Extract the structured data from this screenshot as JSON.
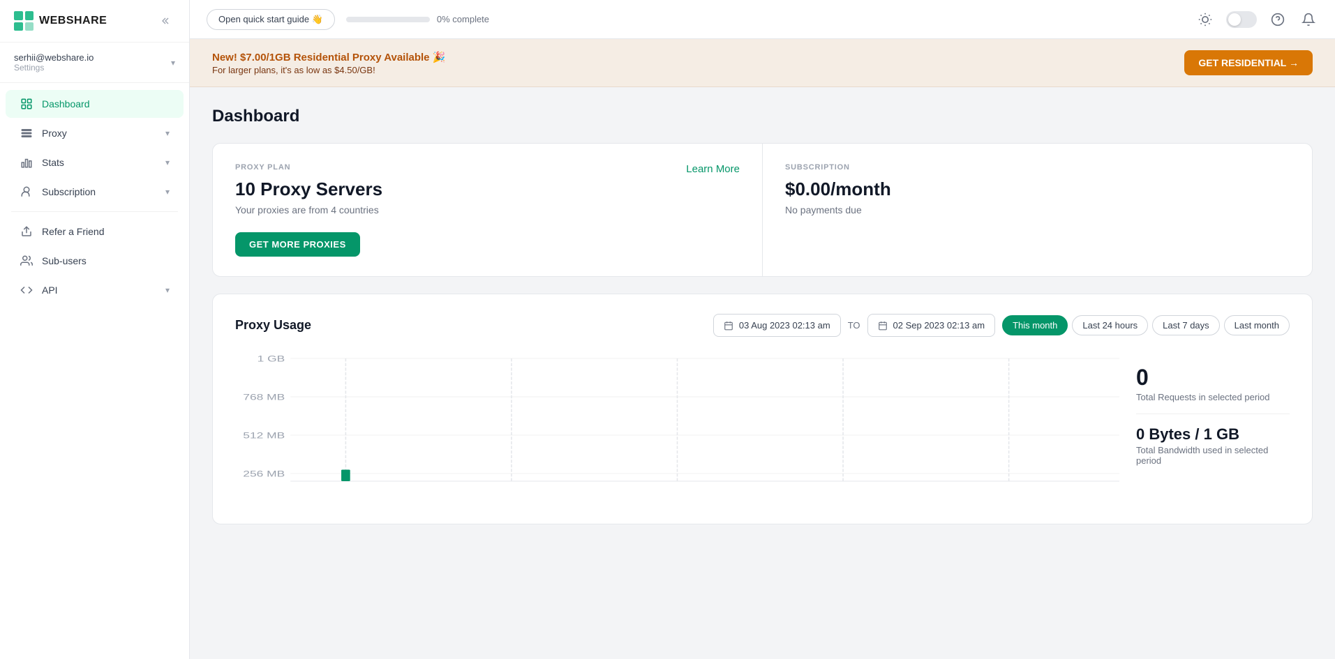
{
  "sidebar": {
    "logo_text": "WEBSHARE",
    "user_email": "serhii@webshare.io",
    "user_settings_label": "Settings",
    "collapse_icon": "◀◀",
    "nav_items": [
      {
        "id": "dashboard",
        "label": "Dashboard",
        "icon": "grid",
        "active": true,
        "has_chevron": false
      },
      {
        "id": "proxy",
        "label": "Proxy",
        "icon": "list",
        "active": false,
        "has_chevron": true
      },
      {
        "id": "stats",
        "label": "Stats",
        "icon": "bar-chart",
        "active": false,
        "has_chevron": true
      },
      {
        "id": "subscription",
        "label": "Subscription",
        "icon": "user-circle",
        "active": false,
        "has_chevron": true
      },
      {
        "id": "refer",
        "label": "Refer a Friend",
        "icon": "gift",
        "active": false,
        "has_chevron": false
      },
      {
        "id": "subusers",
        "label": "Sub-users",
        "icon": "users",
        "active": false,
        "has_chevron": false
      },
      {
        "id": "api",
        "label": "API",
        "icon": "code",
        "active": false,
        "has_chevron": true
      }
    ]
  },
  "topbar": {
    "quick_start_label": "Open quick start guide 👋",
    "progress_percent": 0,
    "progress_text": "0% complete",
    "help_icon": "?",
    "bell_icon": "🔔"
  },
  "banner": {
    "title": "New! $7.00/1GB Residential Proxy Available 🎉",
    "subtitle": "For larger plans, it's as low as $4.50/GB!",
    "cta_label": "GET RESIDENTIAL →"
  },
  "page": {
    "title": "Dashboard",
    "proxy_plan_card": {
      "label": "PROXY PLAN",
      "title": "10 Proxy Servers",
      "subtitle": "Your proxies are from 4 countries",
      "link_label": "Learn More",
      "cta_label": "GET MORE PROXIES"
    },
    "subscription_card": {
      "label": "SUBSCRIPTION",
      "title": "$0.00/month",
      "subtitle": "No payments due"
    },
    "proxy_usage": {
      "title": "Proxy Usage",
      "date_from": "03 Aug 2023 02:13 am",
      "date_to": "02 Sep 2023 02:13 am",
      "date_separator": "TO",
      "filters": [
        {
          "id": "this-month",
          "label": "This month",
          "active": true
        },
        {
          "id": "last-24-hours",
          "label": "Last 24 hours",
          "active": false
        },
        {
          "id": "last-7-days",
          "label": "Last 7 days",
          "active": false
        },
        {
          "id": "last-month",
          "label": "Last month",
          "active": false
        }
      ],
      "chart_y_labels": [
        "1 GB",
        "768 MB",
        "512 MB"
      ],
      "total_requests": "0",
      "total_requests_label": "Total Requests in selected period",
      "bandwidth": "0 Bytes / 1 GB",
      "bandwidth_label": "Total Bandwidth used in selected period"
    }
  },
  "colors": {
    "green": "#059669",
    "orange": "#d97706",
    "light_orange_bg": "#f5ede4"
  }
}
